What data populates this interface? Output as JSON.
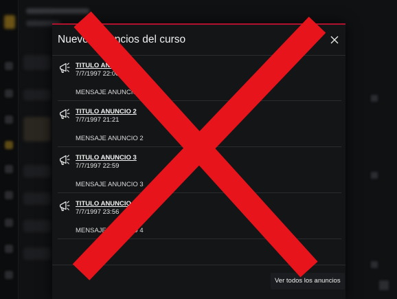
{
  "modal": {
    "title": "Nuevos anuncios del curso",
    "close_icon": "close-icon",
    "announcements": [
      {
        "title": "TITULO ANUNCIO 1",
        "date": "7/7/1997 22:06",
        "message": "MENSAJE ANUNCIO 1",
        "icon": "megaphone-icon"
      },
      {
        "title": "TITULO ANUNCIO 2",
        "date": "7/7/1997 21:21",
        "message": "MENSAJE ANUNCIO 2",
        "icon": "megaphone-icon"
      },
      {
        "title": "TITULO ANUNCIO 3",
        "date": "7/7/1997 22:59",
        "message": "MENSAJE ANUNCIO 3",
        "icon": "megaphone-icon"
      },
      {
        "title": "TITULO ANUNCIO 4",
        "date": "7/7/1997 23:56",
        "message": "MENSAJE ANUNCIO 4",
        "icon": "megaphone-icon"
      }
    ],
    "footer_button": "Ver todos los anuncios"
  },
  "colors": {
    "accent": "#b3122f",
    "overlay_x": "#e8141c",
    "modal_bg": "#141517",
    "text": "#f2f2f2"
  }
}
